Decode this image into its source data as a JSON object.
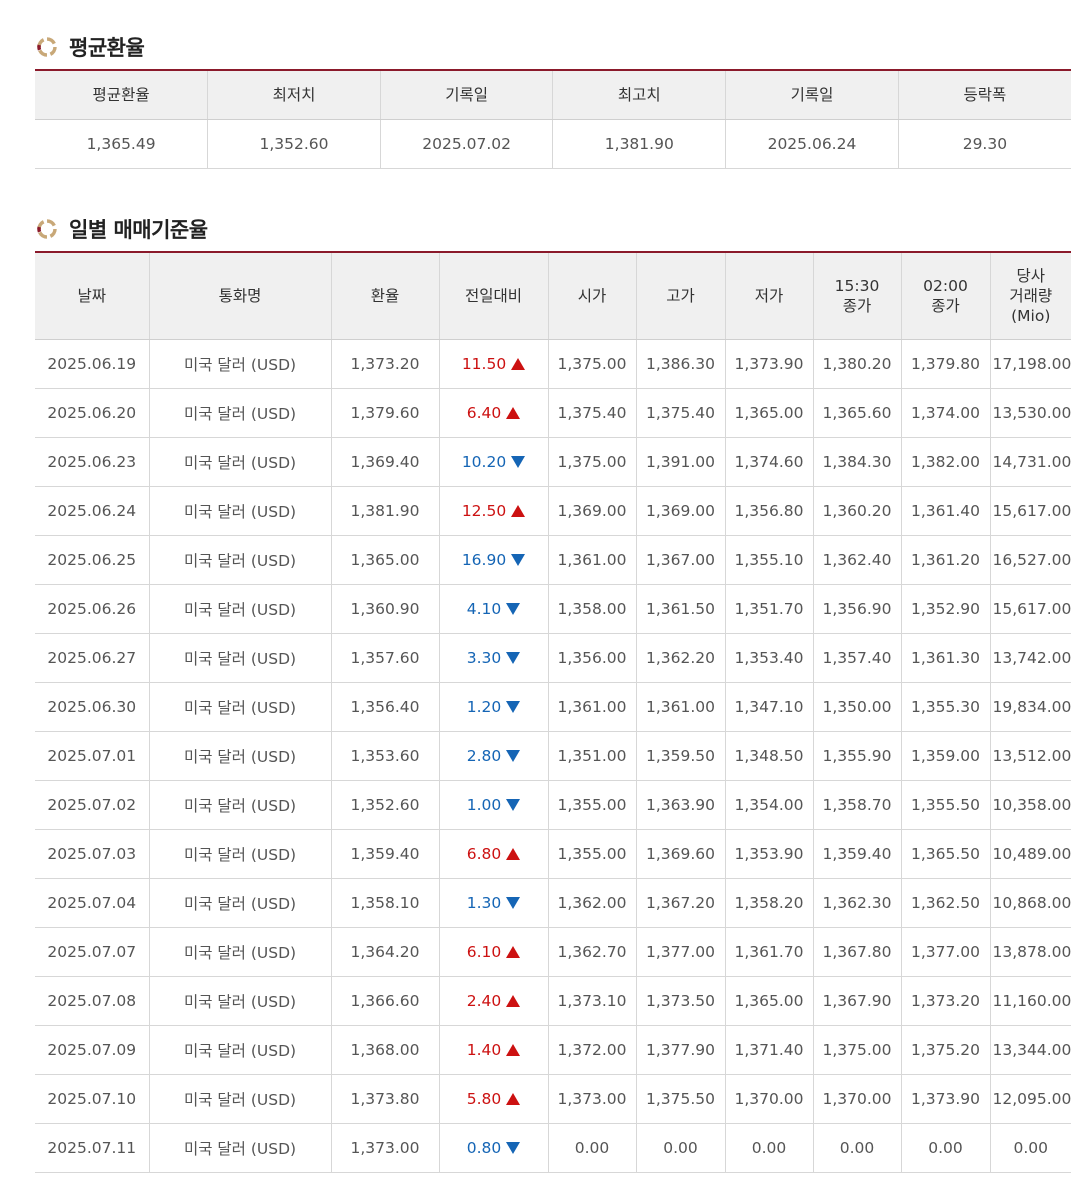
{
  "avg_section": {
    "title": "평균환율",
    "headers": [
      "평균환율",
      "최저치",
      "기록일",
      "최고치",
      "기록일",
      "등락폭"
    ],
    "values": [
      "1,365.49",
      "1,352.60",
      "2025.07.02",
      "1,381.90",
      "2025.06.24",
      "29.30"
    ]
  },
  "daily_section": {
    "title": "일별 매매기준율",
    "headers": [
      "날짜",
      "통화명",
      "환율",
      "전일대비",
      "시가",
      "고가",
      "저가",
      "15:30\n종가",
      "02:00\n종가",
      "당사\n거래량\n(Mio)"
    ],
    "rows": [
      {
        "date": "2025.06.19",
        "currency": "미국 달러 (USD)",
        "rate": "1,373.20",
        "change": "11.50",
        "dir": "up",
        "open": "1,375.00",
        "high": "1,386.30",
        "low": "1,373.90",
        "close1530": "1,380.20",
        "close0200": "1,379.80",
        "volume": "17,198.00"
      },
      {
        "date": "2025.06.20",
        "currency": "미국 달러 (USD)",
        "rate": "1,379.60",
        "change": "6.40",
        "dir": "up",
        "open": "1,375.40",
        "high": "1,375.40",
        "low": "1,365.00",
        "close1530": "1,365.60",
        "close0200": "1,374.00",
        "volume": "13,530.00"
      },
      {
        "date": "2025.06.23",
        "currency": "미국 달러 (USD)",
        "rate": "1,369.40",
        "change": "10.20",
        "dir": "down",
        "open": "1,375.00",
        "high": "1,391.00",
        "low": "1,374.60",
        "close1530": "1,384.30",
        "close0200": "1,382.00",
        "volume": "14,731.00"
      },
      {
        "date": "2025.06.24",
        "currency": "미국 달러 (USD)",
        "rate": "1,381.90",
        "change": "12.50",
        "dir": "up",
        "open": "1,369.00",
        "high": "1,369.00",
        "low": "1,356.80",
        "close1530": "1,360.20",
        "close0200": "1,361.40",
        "volume": "15,617.00"
      },
      {
        "date": "2025.06.25",
        "currency": "미국 달러 (USD)",
        "rate": "1,365.00",
        "change": "16.90",
        "dir": "down",
        "open": "1,361.00",
        "high": "1,367.00",
        "low": "1,355.10",
        "close1530": "1,362.40",
        "close0200": "1,361.20",
        "volume": "16,527.00"
      },
      {
        "date": "2025.06.26",
        "currency": "미국 달러 (USD)",
        "rate": "1,360.90",
        "change": "4.10",
        "dir": "down",
        "open": "1,358.00",
        "high": "1,361.50",
        "low": "1,351.70",
        "close1530": "1,356.90",
        "close0200": "1,352.90",
        "volume": "15,617.00"
      },
      {
        "date": "2025.06.27",
        "currency": "미국 달러 (USD)",
        "rate": "1,357.60",
        "change": "3.30",
        "dir": "down",
        "open": "1,356.00",
        "high": "1,362.20",
        "low": "1,353.40",
        "close1530": "1,357.40",
        "close0200": "1,361.30",
        "volume": "13,742.00"
      },
      {
        "date": "2025.06.30",
        "currency": "미국 달러 (USD)",
        "rate": "1,356.40",
        "change": "1.20",
        "dir": "down",
        "open": "1,361.00",
        "high": "1,361.00",
        "low": "1,347.10",
        "close1530": "1,350.00",
        "close0200": "1,355.30",
        "volume": "19,834.00"
      },
      {
        "date": "2025.07.01",
        "currency": "미국 달러 (USD)",
        "rate": "1,353.60",
        "change": "2.80",
        "dir": "down",
        "open": "1,351.00",
        "high": "1,359.50",
        "low": "1,348.50",
        "close1530": "1,355.90",
        "close0200": "1,359.00",
        "volume": "13,512.00"
      },
      {
        "date": "2025.07.02",
        "currency": "미국 달러 (USD)",
        "rate": "1,352.60",
        "change": "1.00",
        "dir": "down",
        "open": "1,355.00",
        "high": "1,363.90",
        "low": "1,354.00",
        "close1530": "1,358.70",
        "close0200": "1,355.50",
        "volume": "10,358.00"
      },
      {
        "date": "2025.07.03",
        "currency": "미국 달러 (USD)",
        "rate": "1,359.40",
        "change": "6.80",
        "dir": "up",
        "open": "1,355.00",
        "high": "1,369.60",
        "low": "1,353.90",
        "close1530": "1,359.40",
        "close0200": "1,365.50",
        "volume": "10,489.00"
      },
      {
        "date": "2025.07.04",
        "currency": "미국 달러 (USD)",
        "rate": "1,358.10",
        "change": "1.30",
        "dir": "down",
        "open": "1,362.00",
        "high": "1,367.20",
        "low": "1,358.20",
        "close1530": "1,362.30",
        "close0200": "1,362.50",
        "volume": "10,868.00"
      },
      {
        "date": "2025.07.07",
        "currency": "미국 달러 (USD)",
        "rate": "1,364.20",
        "change": "6.10",
        "dir": "up",
        "open": "1,362.70",
        "high": "1,377.00",
        "low": "1,361.70",
        "close1530": "1,367.80",
        "close0200": "1,377.00",
        "volume": "13,878.00"
      },
      {
        "date": "2025.07.08",
        "currency": "미국 달러 (USD)",
        "rate": "1,366.60",
        "change": "2.40",
        "dir": "up",
        "open": "1,373.10",
        "high": "1,373.50",
        "low": "1,365.00",
        "close1530": "1,367.90",
        "close0200": "1,373.20",
        "volume": "11,160.00"
      },
      {
        "date": "2025.07.09",
        "currency": "미국 달러 (USD)",
        "rate": "1,368.00",
        "change": "1.40",
        "dir": "up",
        "open": "1,372.00",
        "high": "1,377.90",
        "low": "1,371.40",
        "close1530": "1,375.00",
        "close0200": "1,375.20",
        "volume": "13,344.00"
      },
      {
        "date": "2025.07.10",
        "currency": "미국 달러 (USD)",
        "rate": "1,373.80",
        "change": "5.80",
        "dir": "up",
        "open": "1,373.00",
        "high": "1,375.50",
        "low": "1,370.00",
        "close1530": "1,370.00",
        "close0200": "1,373.90",
        "volume": "12,095.00"
      },
      {
        "date": "2025.07.11",
        "currency": "미국 달러 (USD)",
        "rate": "1,373.00",
        "change": "0.80",
        "dir": "down",
        "open": "0.00",
        "high": "0.00",
        "low": "0.00",
        "close1530": "0.00",
        "close0200": "0.00",
        "volume": "0.00"
      }
    ]
  },
  "colors": {
    "accent_line": "#8b1a2b",
    "up": "#cc1111",
    "down": "#1565b5",
    "header_bg": "#f0f0f0"
  },
  "icons": {
    "section": "ring-bullet-icon",
    "up": "triangle-up-icon",
    "down": "triangle-down-icon"
  }
}
